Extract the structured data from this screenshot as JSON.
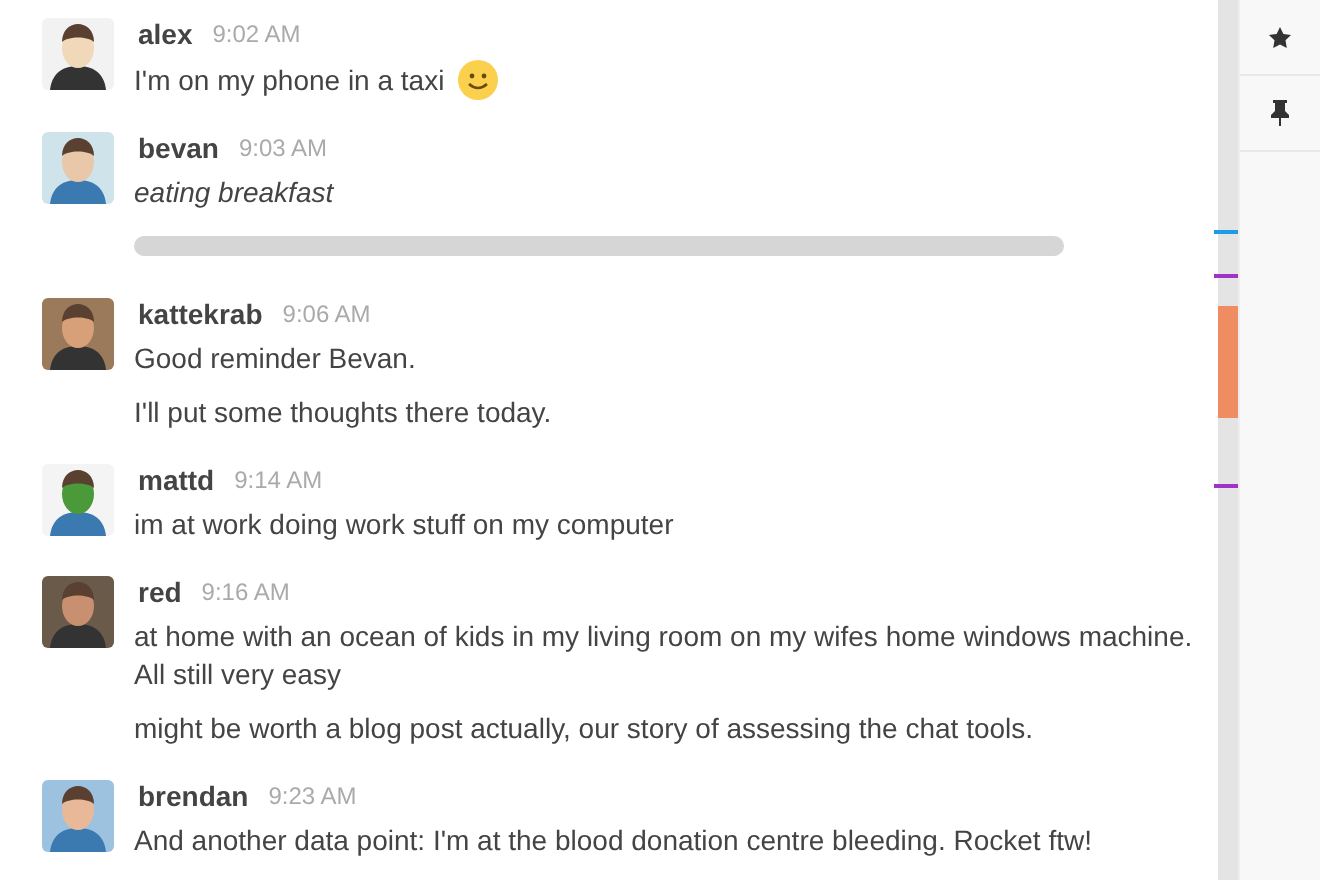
{
  "messages": [
    {
      "user": "alex",
      "time": "9:02 AM",
      "lines": [
        {
          "text": "I'm on my phone in a taxi",
          "kind": "plain",
          "emoji": true
        }
      ]
    },
    {
      "user": "bevan",
      "time": "9:03 AM",
      "lines": [
        {
          "text": "eating breakfast",
          "kind": "italic",
          "emoji": false
        },
        {
          "kind": "redacted",
          "emoji": false
        }
      ]
    },
    {
      "user": "kattekrab",
      "time": "9:06 AM",
      "lines": [
        {
          "text": "Good reminder Bevan.",
          "kind": "plain",
          "emoji": false
        },
        {
          "text": "I'll put some thoughts there today.",
          "kind": "plain",
          "emoji": false
        }
      ]
    },
    {
      "user": "mattd",
      "time": "9:14 AM",
      "lines": [
        {
          "text": "im at work doing work stuff on my computer",
          "kind": "plain",
          "emoji": false
        }
      ]
    },
    {
      "user": "red",
      "time": "9:16 AM",
      "lines": [
        {
          "text": "at home with an ocean of kids in my living room on my wifes home windows machine.\nAll still very easy",
          "kind": "plain",
          "emoji": false
        },
        {
          "text": "might be worth a blog post actually, our story of assessing the chat tools.",
          "kind": "plain",
          "emoji": false
        }
      ]
    },
    {
      "user": "brendan",
      "time": "9:23 AM",
      "lines": [
        {
          "text": "And another data point: I'm at the blood donation centre bleeding. Rocket ftw!",
          "kind": "plain",
          "emoji": false
        }
      ]
    }
  ]
}
